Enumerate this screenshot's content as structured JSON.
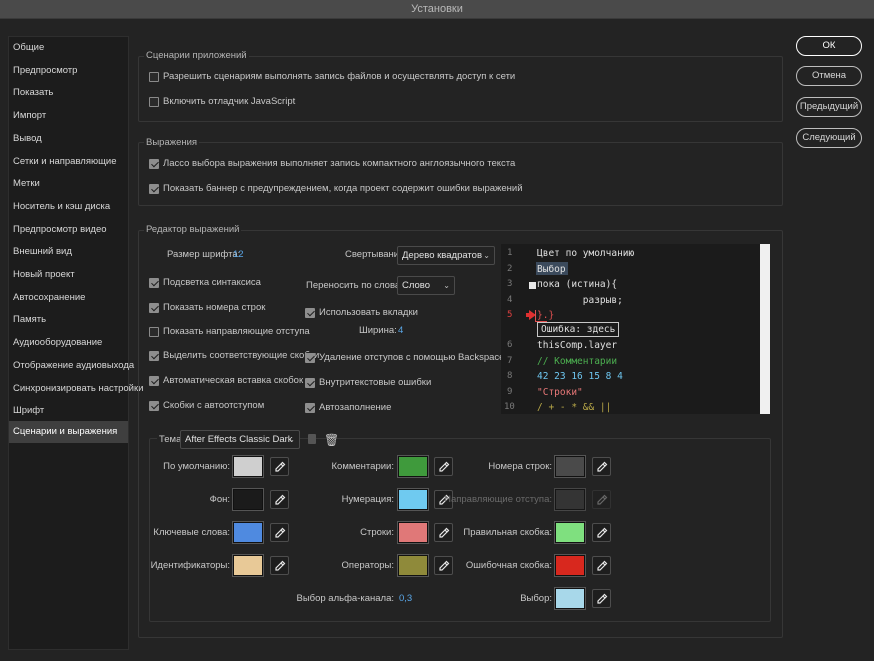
{
  "window": {
    "title": "Установки"
  },
  "sidebar": {
    "items": [
      {
        "label": "Общие"
      },
      {
        "label": "Предпросмотр"
      },
      {
        "label": "Показать"
      },
      {
        "label": "Импорт"
      },
      {
        "label": "Вывод"
      },
      {
        "label": "Сетки и направляющие"
      },
      {
        "label": "Метки"
      },
      {
        "label": "Носитель и кэш диска"
      },
      {
        "label": "Предпросмотр видео"
      },
      {
        "label": "Внешний вид"
      },
      {
        "label": "Новый проект"
      },
      {
        "label": "Автосохранение"
      },
      {
        "label": "Память"
      },
      {
        "label": "Аудиооборудование"
      },
      {
        "label": "Отображение аудиовыхода"
      },
      {
        "label": "Синхронизировать настройки"
      },
      {
        "label": "Шрифт"
      },
      {
        "label": "Сценарии и выражения"
      }
    ],
    "active_index": 17
  },
  "buttons": {
    "ok": "ОК",
    "cancel": "Отмена",
    "previous": "Предыдущий",
    "next": "Следующий"
  },
  "app_scripts": {
    "title": "Сценарии приложений",
    "allow_write": {
      "label": "Разрешить сценариям выполнять запись файлов и осуществлять доступ к сети",
      "checked": false
    },
    "enable_debugger": {
      "label": "Включить отладчик JavaScript",
      "checked": false
    }
  },
  "expressions": {
    "title": "Выражения",
    "lasso": {
      "label": "Лассо выбора выражения выполняет запись компактного англоязычного текста",
      "checked": true
    },
    "banner": {
      "label": "Показать баннер с предупреждением, когда проект содержит ошибки выражений",
      "checked": true
    }
  },
  "editor": {
    "title": "Редактор выражений",
    "font_size_label": "Размер шрифта:",
    "font_size_value": "12",
    "folding_label": "Свертывание:",
    "folding_value": "Дерево квадратов",
    "wrap_label": "Переносить по словам:",
    "wrap_value": "Слово",
    "width_label": "Ширина:",
    "width_value": "4",
    "left_options": [
      {
        "label": "Подсветка синтаксиса",
        "checked": true
      },
      {
        "label": "Показать номера строк",
        "checked": true
      },
      {
        "label": "Показать направляющие отступа",
        "checked": false
      },
      {
        "label": "Выделить соответствующие скобки",
        "checked": true
      },
      {
        "label": "Автоматическая вставка скобок",
        "checked": true
      },
      {
        "label": "Скобки с автоотступом",
        "checked": true
      }
    ],
    "use_tabs": {
      "label": "Использовать вкладки",
      "checked": true
    },
    "right_options": [
      {
        "label": "Удаление отступов с помощью Backspace",
        "checked": true
      },
      {
        "label": "Внутритекстовые ошибки",
        "checked": true
      },
      {
        "label": "Автозаполнение",
        "checked": true
      }
    ],
    "preview": {
      "line_numbers": [
        "1",
        "2",
        "3",
        "4",
        "5",
        "6",
        "7",
        "8",
        "9",
        "10"
      ],
      "lines": [
        {
          "text": "Цвет по умолчанию",
          "color": "#e0e0e0"
        },
        {
          "text": "Выбор",
          "color": "#e0e0e0"
        },
        {
          "text": "пока (истина){",
          "color": "#e0e0e0"
        },
        {
          "text": "        разрыв;",
          "color": "#e0e0e0"
        },
        {
          "text": "}.}",
          "color": "#e05050"
        },
        {
          "text": "thisComp.layer",
          "color": "#e0e0e0"
        },
        {
          "text": "// Комментарии",
          "color": "#4caf50"
        },
        {
          "text": "42 23 16 15 8 4",
          "color": "#6ec6f0"
        },
        {
          "text": "\"Строки\"",
          "color": "#e87878"
        },
        {
          "text": "/ + - * && ||",
          "color": "#b8a848"
        }
      ],
      "error_tip": "Ошибка: здесь"
    }
  },
  "theme": {
    "label": "Тема:",
    "value": "After Effects Classic Dark",
    "alpha_label": "Выбор альфа-канала:",
    "alpha_value": "0,3",
    "colors": [
      {
        "label": "По умолчанию:",
        "color": "#cfcfcf",
        "disabled": false
      },
      {
        "label": "Фон:",
        "color": "#1b1b1b",
        "disabled": false
      },
      {
        "label": "Ключевые слова:",
        "color": "#4f8ae0",
        "disabled": false
      },
      {
        "label": "Идентификаторы:",
        "color": "#e8c997",
        "disabled": false
      },
      {
        "label": "Комментарии:",
        "color": "#3f9a3c",
        "disabled": false
      },
      {
        "label": "Нумерация:",
        "color": "#6fcaf0",
        "disabled": false
      },
      {
        "label": "Строки:",
        "color": "#e07878",
        "disabled": false
      },
      {
        "label": "Операторы:",
        "color": "#8f8a3a",
        "disabled": false
      },
      {
        "label": "Номера строк:",
        "color": "#4a4a4a",
        "disabled": false
      },
      {
        "label": "Направляющие отступа:",
        "color": "#3c3c3c",
        "disabled": true
      },
      {
        "label": "Правильная скобка:",
        "color": "#7fe07f",
        "disabled": false
      },
      {
        "label": "Ошибочная скобка:",
        "color": "#d8281e",
        "disabled": false
      },
      {
        "label": "Выбор:",
        "color": "#a8d8ea",
        "disabled": false
      }
    ]
  }
}
